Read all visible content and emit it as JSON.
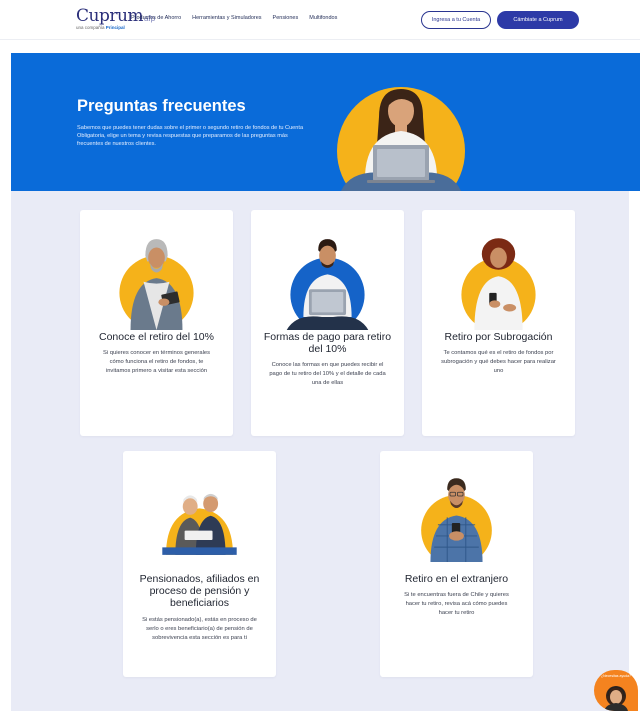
{
  "header": {
    "logo": "Cuprum",
    "logo_suffix": "afp",
    "logo_tagline_prefix": "una compañía",
    "logo_tagline_brand": "Principal",
    "nav": [
      "Productos de Ahorro",
      "Herramientas y Simuladores",
      "Pensiones",
      "Multifondos"
    ],
    "login_button": "Ingresa a tu Cuenta",
    "switch_button": "Cámbiate a Cuprum"
  },
  "hero": {
    "title": "Preguntas frecuentes",
    "text": "Sabemos que puedes tener dudas sobre el primer o segundo retiro de fondos de tu Cuenta Obligatoria, elige un tema y revisa respuestas que preparamos de las preguntas más frecuentes de nuestros clientes."
  },
  "cards": [
    {
      "title": "Conoce el retiro del 10%",
      "text": "Si quieres conocer en términos generales cómo funciona el retiro de fondos, te invitamos primero a visitar esta sección"
    },
    {
      "title": "Formas de pago para retiro del 10%",
      "text": "Conoce las formas en que puedes recibir el pago de tu retiro del 10% y el detalle de cada una de ellas"
    },
    {
      "title": "Retiro por Subrogación",
      "text": "Te contamos qué es el retiro de fondos por subrogación y qué debes hacer para realizar uno"
    },
    {
      "title": "Pensionados, afiliados en proceso de pensión y beneficiarios",
      "text": "Si estás pensionado(a), estás en proceso de serlo o eres beneficiario(a) de pensión de sobrevivencia esta sección es para ti"
    },
    {
      "title": "Retiro en el extranjero",
      "text": "Si te encuentras fuera de Chile y quieres hacer tu retiro, revisa acá cómo puedes hacer tu retiro"
    }
  ],
  "help": {
    "label": "¿Necesitas ayuda?"
  },
  "colors": {
    "brand_blue": "#0a6bd9",
    "navy": "#2d3aa7",
    "accent_yellow": "#f5b21a",
    "help_orange": "#f4831f",
    "content_bg": "#e9ebf6"
  }
}
